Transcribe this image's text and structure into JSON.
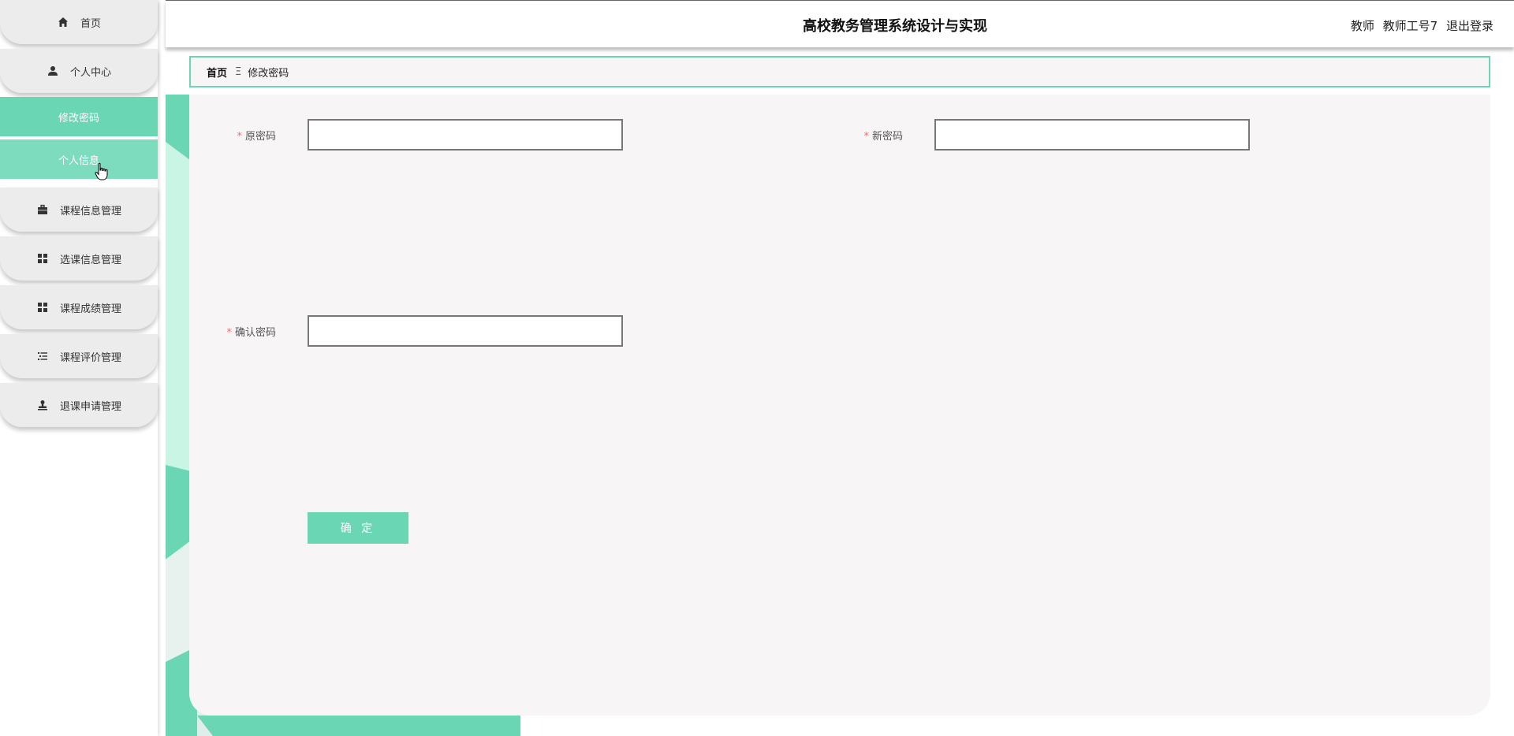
{
  "header": {
    "title": "高校教务管理系统设计与实现",
    "role": "教师",
    "username": "教师工号7",
    "logout_label": "退出登录"
  },
  "sidebar": {
    "items": [
      {
        "label": "首页",
        "icon": "home-icon"
      },
      {
        "label": "个人中心",
        "icon": "user-icon"
      },
      {
        "label": "课程信息管理",
        "icon": "briefcase-icon"
      },
      {
        "label": "选课信息管理",
        "icon": "grid-icon"
      },
      {
        "label": "课程成绩管理",
        "icon": "grid-icon"
      },
      {
        "label": "课程评价管理",
        "icon": "list-icon"
      },
      {
        "label": "退课申请管理",
        "icon": "stamp-icon"
      }
    ],
    "sub_items": [
      {
        "label": "修改密码"
      },
      {
        "label": "个人信息"
      }
    ]
  },
  "breadcrumb": {
    "home": "首页",
    "separator": "Ξ",
    "current": "修改密码"
  },
  "form": {
    "old_password": {
      "label": "原密码",
      "value": ""
    },
    "new_password": {
      "label": "新密码",
      "value": ""
    },
    "confirm_password": {
      "label": "确认密码",
      "value": ""
    },
    "required_mark": "*",
    "submit_label": "确 定"
  },
  "colors": {
    "accent": "#6ad6b3",
    "card_bg": "#f7f5f5",
    "nav_bg": "#ececec"
  }
}
